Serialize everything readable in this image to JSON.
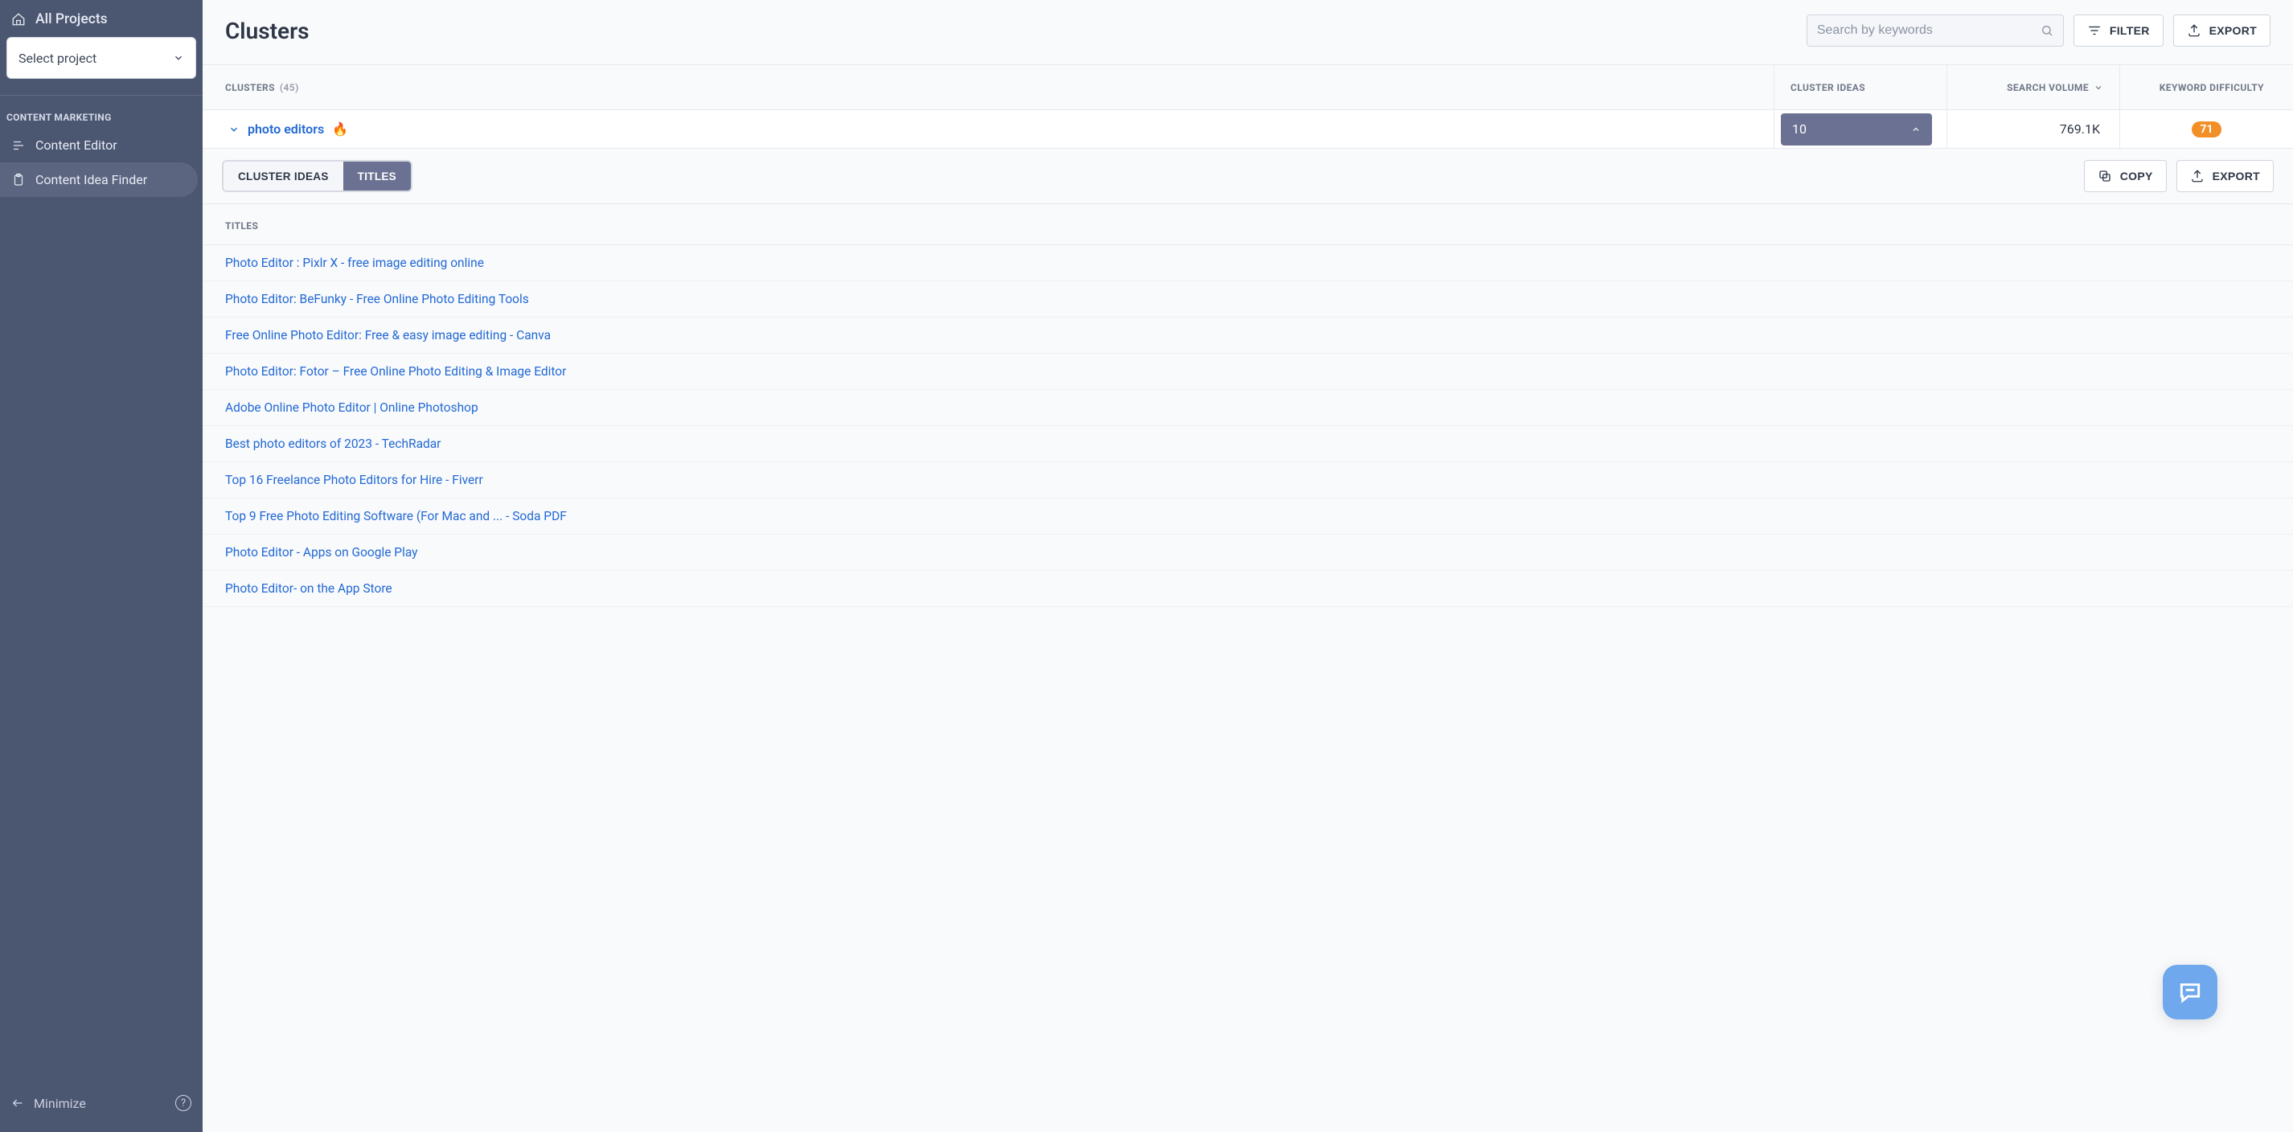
{
  "sidebar": {
    "allProjects": "All Projects",
    "selectProjectPlaceholder": "Select project",
    "sectionLabel": "CONTENT MARKETING",
    "items": [
      {
        "label": "Content Editor"
      },
      {
        "label": "Content Idea Finder"
      }
    ],
    "minimize": "Minimize",
    "helpGlyph": "?"
  },
  "header": {
    "title": "Clusters",
    "searchPlaceholder": "Search by keywords",
    "filterLabel": "FILTER",
    "exportLabel": "EXPORT"
  },
  "table": {
    "columns": {
      "clusters": "CLUSTERS",
      "clustersCount": "(45)",
      "ideas": "CLUSTER IDEAS",
      "searchVolume": "SEARCH VOLUME",
      "kd": "KEYWORD DIFFICULTY"
    },
    "expanded": {
      "name": "photo editors",
      "hot": true,
      "ideasSelected": "10",
      "searchVolume": "769.1K",
      "kd": "71"
    }
  },
  "subtoolbar": {
    "tabIdeas": "CLUSTER IDEAS",
    "tabTitles": "TITLES",
    "copy": "COPY",
    "export": "EXPORT"
  },
  "titles": {
    "header": "TITLES",
    "rows": [
      "Photo Editor : Pixlr X - free image editing online",
      "Photo Editor: BeFunky - Free Online Photo Editing Tools",
      "Free Online Photo Editor: Free & easy image editing - Canva",
      "Photo Editor: Fotor – Free Online Photo Editing & Image Editor",
      "Adobe Online Photo Editor | Online Photoshop",
      "Best photo editors of 2023 - TechRadar",
      "Top 16 Freelance Photo Editors for Hire - Fiverr",
      "Top 9 Free Photo Editing Software (For Mac and ... - Soda PDF",
      "Photo Editor - Apps on Google Play",
      "Photo Editor- on the App Store"
    ]
  },
  "colors": {
    "accent": "#2269d4",
    "sidebar": "#4b5671",
    "kdBadge": "#f28f26"
  }
}
